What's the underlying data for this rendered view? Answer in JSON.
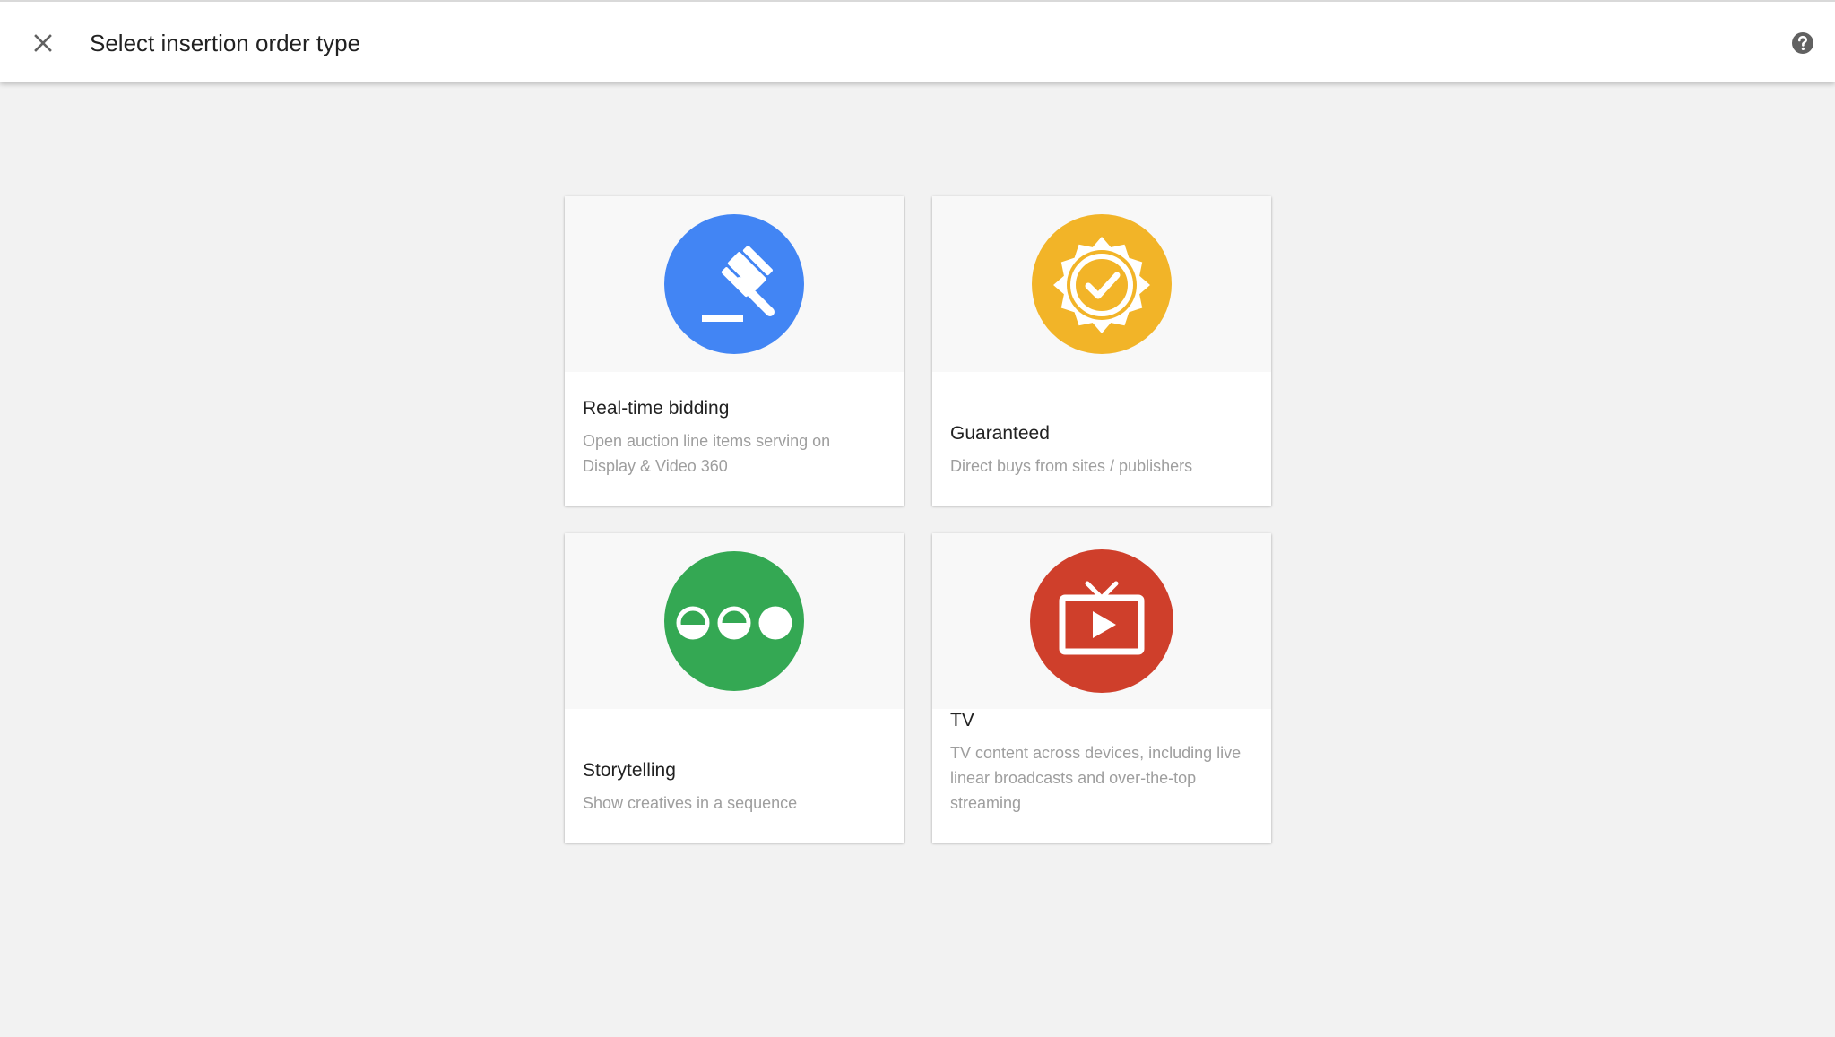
{
  "header": {
    "title": "Select insertion order type",
    "close_icon": "close-icon",
    "help_icon": "help-icon"
  },
  "cards": [
    {
      "title": "Real-time bidding",
      "description": "Open auction line items serving on Display & Video 360",
      "icon": "gavel-icon",
      "color": "#4285f4"
    },
    {
      "title": "Guaranteed",
      "description": "Direct buys from sites / publishers",
      "icon": "verified-badge-icon",
      "color": "#f2b428"
    },
    {
      "title": "Storytelling",
      "description": "Show creatives in a sequence",
      "icon": "sequence-icon",
      "color": "#34a853"
    },
    {
      "title": "TV",
      "description": "TV content across devices, including live linear broadcasts and over-the-top streaming",
      "icon": "tv-icon",
      "color": "#cf3f2b"
    }
  ]
}
